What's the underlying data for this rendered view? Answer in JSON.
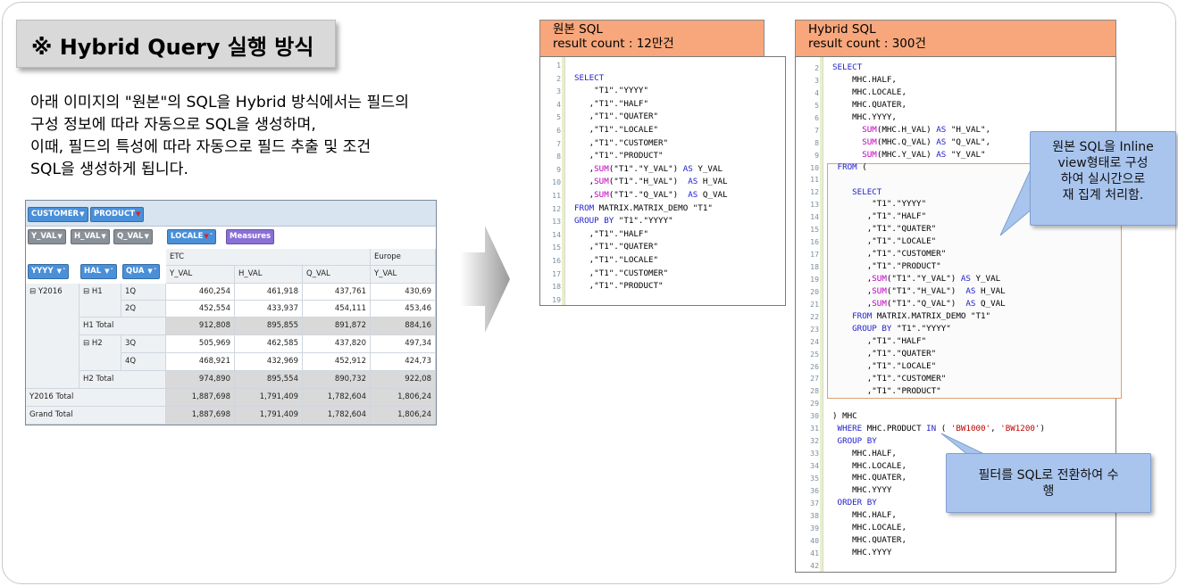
{
  "title": "※ Hybrid Query 실행 방식",
  "description": [
    "아래 이미지의 \"원본\"의 SQL을 Hybrid 방식에서는 필드의",
    "구성 정보에 따라 자동으로 SQL을 생성하며,",
    "이때, 필드의 특성에 따라 자동으로 필드 추출 및 조건",
    "SQL을 생성하게 됩니다."
  ],
  "pivot": {
    "filter_fields": [
      "CUSTOMER",
      "PRODUCT"
    ],
    "data_fields": [
      "Y_VAL",
      "H_VAL",
      "Q_VAL"
    ],
    "column_field": "LOCALE",
    "measures_label": "Measures",
    "row_fields": [
      "YYYY",
      "HAL",
      "QUA"
    ],
    "column_groups": [
      "ETC",
      "Europe"
    ],
    "measure_headers": [
      "Y_VAL",
      "H_VAL",
      "Q_VAL",
      "Y_VAL"
    ],
    "year": "Y2016",
    "half1": "H1",
    "half2": "H2",
    "h1_total": "H1  Total",
    "h2_total": "H2  Total",
    "year_total": "Y2016  Total",
    "grand_total": "Grand Total",
    "quarters": [
      "1Q",
      "2Q",
      "3Q",
      "4Q"
    ],
    "rows": {
      "q1": [
        "460,254",
        "461,918",
        "437,761",
        "430,69"
      ],
      "q2": [
        "452,554",
        "433,937",
        "454,111",
        "453,46"
      ],
      "h1t": [
        "912,808",
        "895,855",
        "891,872",
        "884,16"
      ],
      "q3": [
        "505,969",
        "462,585",
        "437,820",
        "497,34"
      ],
      "q4": [
        "468,921",
        "432,969",
        "452,912",
        "424,73"
      ],
      "h2t": [
        "974,890",
        "895,554",
        "890,732",
        "922,08"
      ],
      "yt": [
        "1,887,698",
        "1,791,409",
        "1,782,604",
        "1,806,24"
      ],
      "gt": [
        "1,887,698",
        "1,791,409",
        "1,782,604",
        "1,806,24"
      ]
    }
  },
  "original_sql": {
    "header_line1": "원본 SQL",
    "header_line2": "result count  : 12만건",
    "line_numbers": [
      "1",
      "2",
      "3",
      "4",
      "5",
      "6",
      "7",
      "8",
      "9",
      "10",
      "11",
      "12",
      "13",
      "14",
      "15",
      "16",
      "17",
      "18",
      "19"
    ]
  },
  "hybrid_sql": {
    "header_line1": "Hybrid SQL",
    "header_line2": "result count :  300건",
    "line_numbers": [
      "2",
      "3",
      "4",
      "5",
      "6",
      "7",
      "8",
      "9",
      "10",
      "11",
      "12",
      "13",
      "14",
      "15",
      "16",
      "17",
      "18",
      "19",
      "20",
      "21",
      "22",
      "23",
      "24",
      "25",
      "26",
      "27",
      "28",
      "29",
      "30",
      "31",
      "32",
      "33",
      "34",
      "35",
      "36",
      "37",
      "38",
      "39",
      "40",
      "41",
      "42"
    ]
  },
  "callout_inline": [
    "원본 SQL을  Inline",
    "view형태로  구성",
    "하여  실시간으로",
    "재  집계 처리함."
  ],
  "callout_filter": [
    "필터를 SQL로 전환하여 수",
    "행"
  ],
  "colors": {
    "header_orange": "#f7a77b",
    "callout_blue": "#a9c5ee",
    "keyword_blue": "#1f1fcc",
    "function_magenta": "#c000c0",
    "string_red": "#c00000"
  }
}
